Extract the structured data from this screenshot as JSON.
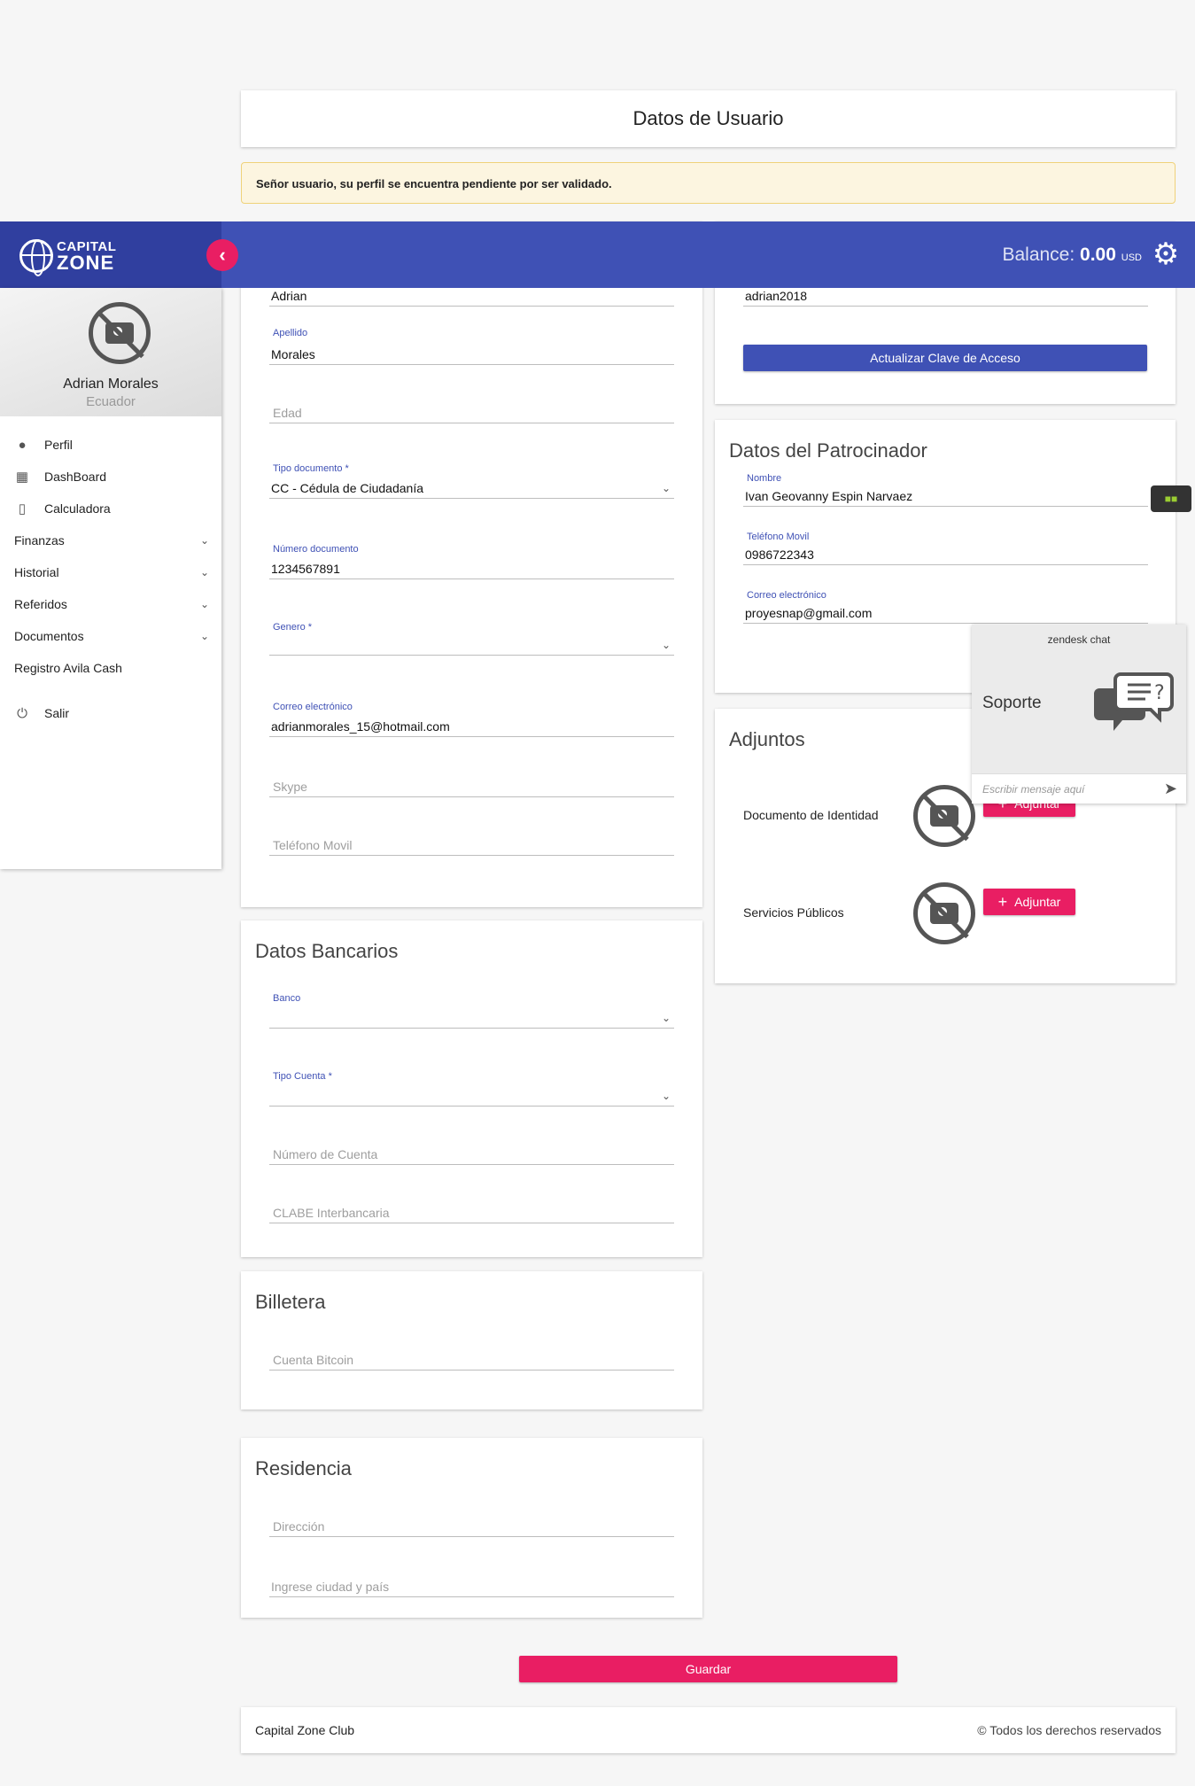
{
  "page": {
    "title": "Datos de Usuario",
    "alert": "Señor usuario, su perfil se encuentra pendiente por ser validado."
  },
  "topbar": {
    "brand_line1": "CAPITAL",
    "brand_line2": "ZONE",
    "balance_label": "Balance:",
    "balance_value": "0.00",
    "balance_currency": "USD"
  },
  "sidebar": {
    "name": "Adrian Morales",
    "country": "Ecuador",
    "items": [
      {
        "label": "Perfil",
        "icon": "person-icon"
      },
      {
        "label": "DashBoard",
        "icon": "dashboard-icon"
      },
      {
        "label": "Calculadora",
        "icon": "phone-icon"
      },
      {
        "label": "Finanzas",
        "icon": "chevron-down-icon"
      },
      {
        "label": "Historial",
        "icon": "chevron-down-icon"
      },
      {
        "label": "Referidos",
        "icon": "chevron-down-icon"
      },
      {
        "label": "Documentos",
        "icon": "chevron-down-icon"
      },
      {
        "label": "Registro Avila Cash",
        "icon": ""
      },
      {
        "label": "Salir",
        "icon": "power-icon"
      }
    ]
  },
  "personal": {
    "nombre_value": "Adrian",
    "apellido_label": "Apellido",
    "apellido_value": "Morales",
    "edad_placeholder": "Edad",
    "tipo_doc_label": "Tipo documento",
    "tipo_doc_value": "CC - Cédula de Ciudadanía",
    "num_doc_label": "Número documento",
    "num_doc_value": "1234567891",
    "genero_label": "Genero",
    "correo_label": "Correo electrónico",
    "correo_value": "adrianmorales_15@hotmail.com",
    "skype_placeholder": "Skype",
    "telefono_placeholder": "Teléfono Movil"
  },
  "access": {
    "usuario_value": "adrian2018",
    "update_button": "Actualizar Clave de Acceso"
  },
  "sponsor": {
    "title": "Datos del Patrocinador",
    "nombre_label": "Nombre",
    "nombre_value": "Ivan Geovanny Espin Narvaez",
    "telefono_label": "Teléfono Movil",
    "telefono_value": "0986722343",
    "correo_label": "Correo electrónico",
    "correo_value": "proyesnap@gmail.com"
  },
  "attachments": {
    "title": "Adjuntos",
    "items": [
      {
        "label": "Documento de Identidad",
        "button": "Adjuntar"
      },
      {
        "label": "Servicios Públicos",
        "button": "Adjuntar"
      }
    ]
  },
  "bank": {
    "title": "Datos Bancarios",
    "banco_label": "Banco",
    "tipo_cuenta_label": "Tipo Cuenta",
    "numero_placeholder": "Número de Cuenta",
    "clabe_placeholder": "CLABE Interbancaria"
  },
  "wallet": {
    "title": "Billetera",
    "bitcoin_placeholder": "Cuenta Bitcoin"
  },
  "residence": {
    "title": "Residencia",
    "direccion_placeholder": "Dirección",
    "ciudad_placeholder": "Ingrese ciudad y país"
  },
  "save_button": "Guardar",
  "chat": {
    "header": "zendesk chat",
    "title": "Soporte",
    "input_placeholder": "Escribir mensaje aquí"
  },
  "footer": {
    "left": "Capital Zone Club",
    "right": "Todos los derechos reservados",
    "copyright_symbol": "©"
  }
}
